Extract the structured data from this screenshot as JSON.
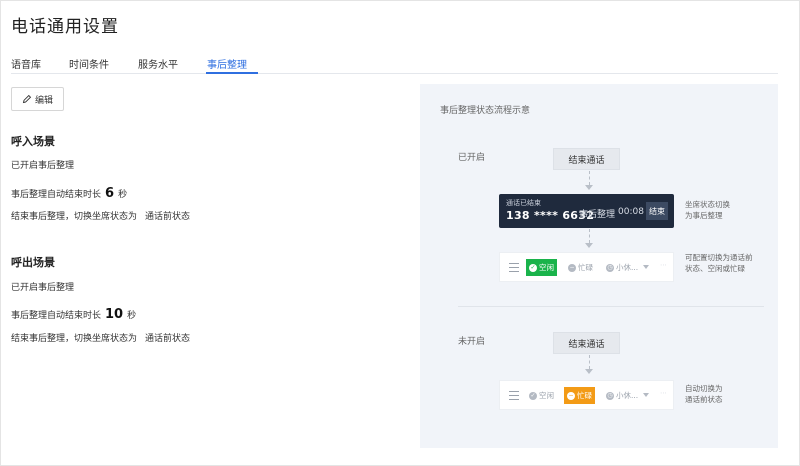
{
  "page": {
    "title": "电话通用设置"
  },
  "tabs": [
    {
      "label": "语音库"
    },
    {
      "label": "时间条件"
    },
    {
      "label": "服务水平"
    },
    {
      "label": "事后整理",
      "active": true
    }
  ],
  "toolbar": {
    "edit_label": "编辑"
  },
  "inbound": {
    "title": "呼入场景",
    "status": "已开启事后整理",
    "auto_end_prefix": "事后整理自动结束时长",
    "auto_end_value": "6",
    "auto_end_unit": "秒",
    "switch_prefix": "结束事后整理，切换坐席状态为",
    "switch_value": "通话前状态"
  },
  "outbound": {
    "title": "呼出场景",
    "status": "已开启事后整理",
    "auto_end_prefix": "事后整理自动结束时长",
    "auto_end_value": "10",
    "auto_end_unit": "秒",
    "switch_prefix": "结束事后整理，切换坐席状态为",
    "switch_value": "通话前状态"
  },
  "diagram": {
    "title": "事后整理状态流程示意",
    "enabled": {
      "label": "已开启",
      "end_call_label": "结束通话",
      "call_bar": {
        "status_small": "通话已结束",
        "number": "138 **** 6632",
        "state": "事后整理",
        "time": "00:08",
        "end_label": "结束"
      },
      "note1": [
        "坐席状态切换",
        "为事后整理"
      ],
      "status_bar": {
        "free": "空闲",
        "busy": "忙碌",
        "rest": "小休..."
      },
      "note2": [
        "可配置切换为通话前",
        "状态、空闲或忙碌"
      ]
    },
    "disabled": {
      "label": "未开启",
      "end_call_label": "结束通话",
      "status_bar": {
        "free": "空闲",
        "busy": "忙碌",
        "rest": "小休..."
      },
      "note": [
        "自动切换为",
        "通话前状态"
      ]
    }
  },
  "colors": {
    "accent": "#2f6fe0",
    "free_green": "#1ab34b",
    "busy_orange": "#f39b16",
    "call_bar_bg": "#1f2a3d",
    "panel_bg": "#f1f4f9"
  }
}
